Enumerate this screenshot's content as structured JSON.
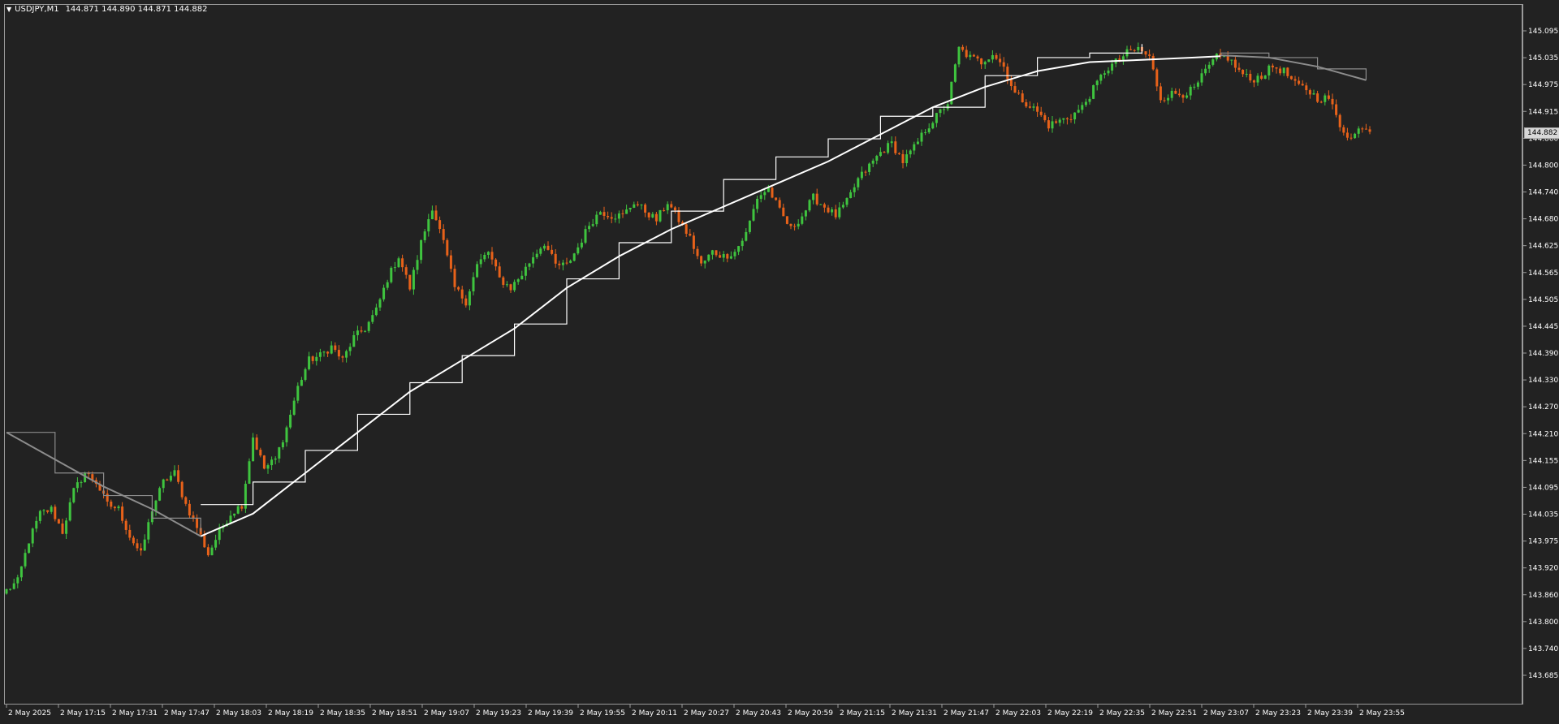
{
  "header": {
    "symbol": "USDJPY,M1",
    "ohlc": "144.871 144.890 144.871 144.882"
  },
  "current_price_label": "144.882",
  "colors": {
    "bull": "#3fc43f",
    "bear": "#e8621a",
    "ma_white": "#ffffff",
    "ma_gray": "#8c8c8c",
    "background": "#222222"
  },
  "chart_data": {
    "type": "candlestick",
    "title": "USDJPY,M1",
    "y_ticks": [
      "145.095",
      "145.035",
      "144.975",
      "144.915",
      "144.860",
      "144.800",
      "144.740",
      "144.680",
      "144.625",
      "144.565",
      "144.505",
      "144.445",
      "144.390",
      "144.330",
      "144.270",
      "144.210",
      "144.155",
      "144.095",
      "144.035",
      "143.975",
      "143.920",
      "143.860",
      "143.800",
      "143.740",
      "143.685"
    ],
    "ylim": [
      143.672,
      145.101
    ],
    "x_ticks": [
      "2 May 2025",
      "2 May 17:15",
      "2 May 17:31",
      "2 May 17:47",
      "2 May 18:03",
      "2 May 18:19",
      "2 May 18:35",
      "2 May 18:51",
      "2 May 19:07",
      "2 May 19:23",
      "2 May 19:39",
      "2 May 19:55",
      "2 May 20:11",
      "2 May 20:27",
      "2 May 20:43",
      "2 May 20:59",
      "2 May 21:15",
      "2 May 21:31",
      "2 May 21:47",
      "2 May 22:03",
      "2 May 22:19",
      "2 May 22:35",
      "2 May 22:51",
      "2 May 23:07",
      "2 May 23:23",
      "2 May 23:39",
      "2 May 23:55"
    ],
    "x_range": [
      "2 May 2025 16:59",
      "2 May 2025 23:59"
    ],
    "minutes_per_bar": 1,
    "close_series": [
      [
        0,
        143.86
      ],
      [
        3,
        143.88
      ],
      [
        6,
        143.97
      ],
      [
        9,
        144.03
      ],
      [
        12,
        144.04
      ],
      [
        15,
        143.99
      ],
      [
        18,
        144.08
      ],
      [
        21,
        144.12
      ],
      [
        24,
        144.1
      ],
      [
        27,
        144.05
      ],
      [
        30,
        144.04
      ],
      [
        33,
        143.98
      ],
      [
        36,
        143.94
      ],
      [
        39,
        144.04
      ],
      [
        42,
        144.1
      ],
      [
        45,
        144.12
      ],
      [
        48,
        144.05
      ],
      [
        51,
        144.0
      ],
      [
        54,
        143.94
      ],
      [
        57,
        143.99
      ],
      [
        60,
        144.03
      ],
      [
        63,
        144.05
      ],
      [
        66,
        144.2
      ],
      [
        69,
        144.13
      ],
      [
        72,
        144.15
      ],
      [
        75,
        144.22
      ],
      [
        78,
        144.31
      ],
      [
        81,
        144.37
      ],
      [
        84,
        144.38
      ],
      [
        87,
        144.4
      ],
      [
        90,
        144.37
      ],
      [
        93,
        144.42
      ],
      [
        96,
        144.44
      ],
      [
        99,
        144.48
      ],
      [
        102,
        144.55
      ],
      [
        105,
        144.6
      ],
      [
        108,
        144.53
      ],
      [
        111,
        144.63
      ],
      [
        114,
        144.71
      ],
      [
        117,
        144.63
      ],
      [
        120,
        144.53
      ],
      [
        123,
        144.5
      ],
      [
        126,
        144.58
      ],
      [
        129,
        144.61
      ],
      [
        132,
        144.55
      ],
      [
        135,
        144.53
      ],
      [
        138,
        144.56
      ],
      [
        141,
        144.6
      ],
      [
        144,
        144.63
      ],
      [
        147,
        144.58
      ],
      [
        150,
        144.58
      ],
      [
        153,
        144.62
      ],
      [
        156,
        144.67
      ],
      [
        159,
        144.7
      ],
      [
        162,
        144.69
      ],
      [
        165,
        144.69
      ],
      [
        168,
        144.72
      ],
      [
        171,
        144.7
      ],
      [
        174,
        144.68
      ],
      [
        177,
        144.72
      ],
      [
        180,
        144.68
      ],
      [
        183,
        144.64
      ],
      [
        186,
        144.58
      ],
      [
        189,
        144.61
      ],
      [
        192,
        144.6
      ],
      [
        195,
        144.61
      ],
      [
        198,
        144.65
      ],
      [
        201,
        144.73
      ],
      [
        204,
        144.75
      ],
      [
        207,
        144.7
      ],
      [
        210,
        144.66
      ],
      [
        213,
        144.69
      ],
      [
        216,
        144.73
      ],
      [
        219,
        144.71
      ],
      [
        222,
        144.69
      ],
      [
        225,
        144.72
      ],
      [
        228,
        144.77
      ],
      [
        231,
        144.8
      ],
      [
        234,
        144.83
      ],
      [
        237,
        144.85
      ],
      [
        240,
        144.81
      ],
      [
        243,
        144.84
      ],
      [
        246,
        144.88
      ],
      [
        249,
        144.91
      ],
      [
        252,
        144.94
      ],
      [
        255,
        145.06
      ],
      [
        258,
        145.04
      ],
      [
        261,
        145.03
      ],
      [
        264,
        145.05
      ],
      [
        267,
        145.02
      ],
      [
        270,
        144.96
      ],
      [
        273,
        144.94
      ],
      [
        276,
        144.92
      ],
      [
        279,
        144.89
      ],
      [
        282,
        144.9
      ],
      [
        285,
        144.91
      ],
      [
        288,
        144.93
      ],
      [
        291,
        144.97
      ],
      [
        294,
        145.01
      ],
      [
        297,
        145.03
      ],
      [
        300,
        145.05
      ],
      [
        303,
        145.06
      ],
      [
        306,
        145.04
      ],
      [
        309,
        144.95
      ],
      [
        312,
        144.96
      ],
      [
        315,
        144.96
      ],
      [
        318,
        144.97
      ],
      [
        321,
        145.01
      ],
      [
        324,
        145.04
      ],
      [
        327,
        145.04
      ],
      [
        330,
        145.01
      ],
      [
        333,
        144.99
      ],
      [
        336,
        145.0
      ],
      [
        339,
        145.02
      ],
      [
        342,
        145.01
      ],
      [
        345,
        144.98
      ],
      [
        348,
        144.97
      ],
      [
        351,
        144.95
      ],
      [
        354,
        144.95
      ],
      [
        357,
        144.89
      ],
      [
        360,
        144.86
      ],
      [
        363,
        144.89
      ],
      [
        365,
        144.88
      ]
    ],
    "series": [
      {
        "style": "white stepped line",
        "points": [
          [
            52,
            144.05
          ],
          [
            66,
            144.1
          ],
          [
            80,
            144.17
          ],
          [
            94,
            144.25
          ],
          [
            108,
            144.32
          ],
          [
            122,
            144.38
          ],
          [
            136,
            144.45
          ],
          [
            150,
            144.55
          ],
          [
            164,
            144.63
          ],
          [
            178,
            144.7
          ],
          [
            192,
            144.77
          ],
          [
            206,
            144.82
          ],
          [
            220,
            144.86
          ],
          [
            234,
            144.91
          ],
          [
            248,
            144.93
          ],
          [
            262,
            145.0
          ],
          [
            276,
            145.04
          ],
          [
            290,
            145.05
          ],
          [
            304,
            145.07
          ]
        ]
      },
      {
        "style": "white smooth line",
        "points": [
          [
            52,
            143.98
          ],
          [
            66,
            144.03
          ],
          [
            80,
            144.12
          ],
          [
            94,
            144.21
          ],
          [
            108,
            144.3
          ],
          [
            122,
            144.37
          ],
          [
            136,
            144.44
          ],
          [
            150,
            144.53
          ],
          [
            164,
            144.6
          ],
          [
            178,
            144.66
          ],
          [
            192,
            144.71
          ],
          [
            206,
            144.76
          ],
          [
            220,
            144.81
          ],
          [
            234,
            144.87
          ],
          [
            248,
            144.93
          ],
          [
            262,
            144.975
          ],
          [
            276,
            145.01
          ],
          [
            290,
            145.03
          ],
          [
            304,
            145.035
          ],
          [
            318,
            145.04
          ],
          [
            325,
            145.043
          ]
        ]
      },
      {
        "style": "gray stepped line",
        "points": [
          [
            0,
            144.21
          ],
          [
            13,
            144.12
          ],
          [
            26,
            144.07
          ],
          [
            39,
            144.02
          ],
          [
            52,
            143.99
          ],
          [
            325,
            145.05
          ],
          [
            338,
            145.04
          ],
          [
            351,
            145.015
          ],
          [
            364,
            144.99
          ]
        ]
      },
      {
        "style": "gray smooth line",
        "points": [
          [
            0,
            144.21
          ],
          [
            13,
            144.15
          ],
          [
            26,
            144.09
          ],
          [
            39,
            144.04
          ],
          [
            52,
            143.98
          ],
          [
            325,
            145.045
          ],
          [
            338,
            145.04
          ],
          [
            351,
            145.02
          ],
          [
            364,
            144.99
          ]
        ]
      }
    ]
  }
}
